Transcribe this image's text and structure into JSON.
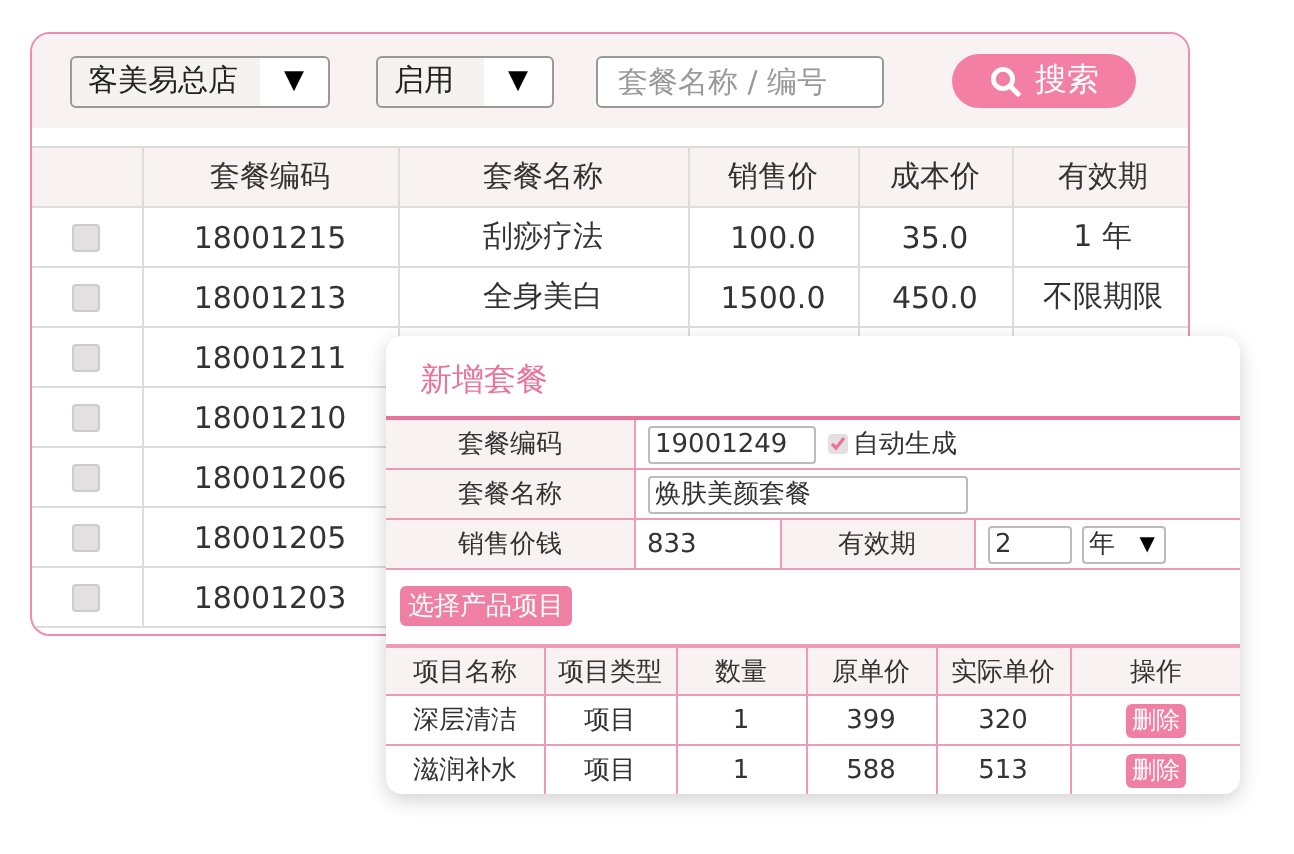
{
  "toolbar": {
    "store_select": {
      "value": "客美易总店",
      "arrow": "▼"
    },
    "status_select": {
      "value": "启用",
      "arrow": "▼"
    },
    "search_field": {
      "placeholder": "套餐名称 / 编号"
    },
    "search_button": "搜索"
  },
  "table": {
    "columns": [
      "套餐编码",
      "套餐名称",
      "销售价",
      "成本价",
      "有效期"
    ],
    "rows": [
      {
        "checked": false,
        "cells": [
          "18001215",
          "刮痧疗法",
          "100.0",
          "35.0",
          "1 年"
        ]
      },
      {
        "checked": false,
        "cells": [
          "18001213",
          "全身美白",
          "1500.0",
          "450.0",
          "不限期限"
        ]
      },
      {
        "checked": false,
        "cells": [
          "18001211"
        ]
      },
      {
        "checked": false,
        "cells": [
          "18001210"
        ]
      },
      {
        "checked": false,
        "cells": [
          "18001206"
        ]
      },
      {
        "checked": false,
        "cells": [
          "18001205"
        ]
      },
      {
        "checked": false,
        "cells": [
          "18001203"
        ]
      }
    ]
  },
  "dialog": {
    "title": "新增套餐",
    "code": {
      "label": "套餐编码",
      "value": "19001249",
      "auto_label": "自动生成",
      "auto_checked": true
    },
    "name": {
      "label": "套餐名称",
      "value": "焕肤美颜套餐"
    },
    "price": {
      "label": "销售价钱",
      "value": "833"
    },
    "validity": {
      "label": "有效期",
      "value": "2",
      "unit": "年",
      "arrow": "▼"
    },
    "choose_button": "选择产品项目",
    "items": {
      "columns": [
        "项目名称",
        "项目类型",
        "数量",
        "原单价",
        "实际单价",
        "操作"
      ],
      "rows": [
        {
          "cells": [
            "深层清洁",
            "项目",
            "1",
            "399",
            "320"
          ],
          "action": "删除"
        },
        {
          "cells": [
            "滋润补水",
            "项目",
            "1",
            "588",
            "513"
          ],
          "action": "删除"
        }
      ]
    }
  }
}
